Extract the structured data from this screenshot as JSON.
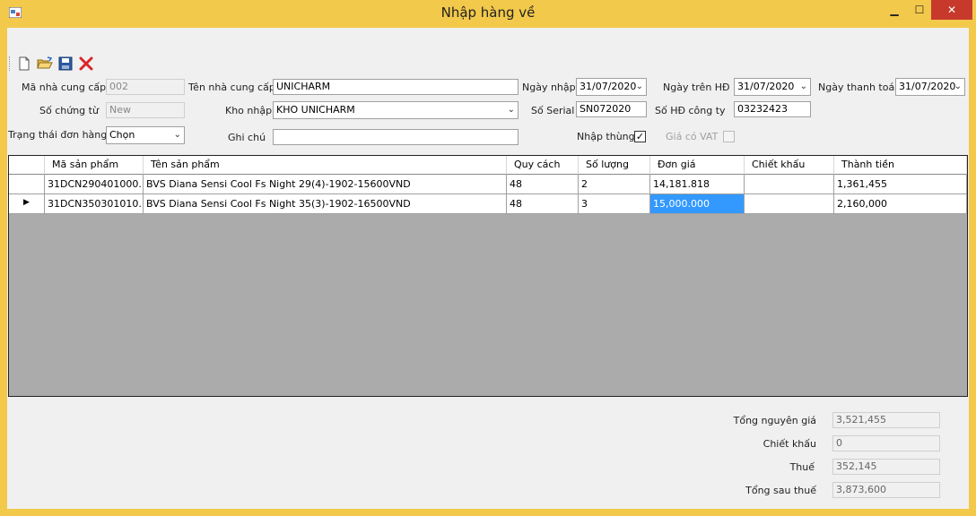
{
  "window": {
    "title": "Nhập hàng về",
    "min_label": "▁",
    "max_label": "☐",
    "close_label": "✕"
  },
  "toolbar": {
    "icons": [
      "new-icon",
      "open-icon",
      "save-icon",
      "delete-icon"
    ]
  },
  "form": {
    "supplier_code": {
      "label": "Mã nhà cung cấp",
      "value": "002"
    },
    "supplier_name": {
      "label": "Tên nhà cung cấp",
      "value": "UNICHARM"
    },
    "import_date": {
      "label": "Ngày nhập",
      "value": "31/07/2020"
    },
    "invoice_date": {
      "label": "Ngày trên HĐ",
      "value": "31/07/2020"
    },
    "payment_date": {
      "label": "Ngày thanh toán",
      "value": "31/07/2020"
    },
    "voucher_no": {
      "label": "Số chứng từ",
      "value": "New"
    },
    "warehouse": {
      "label": "Kho nhập",
      "value": "KHO UNICHARM"
    },
    "serial": {
      "label": "Số Serial",
      "value": "SN072020"
    },
    "company_invoice": {
      "label": "Số HĐ công ty",
      "value": "03232423"
    },
    "order_status": {
      "label": "Trạng thái đơn hàng",
      "value": "Chọn"
    },
    "note": {
      "label": "Ghi chú",
      "value": ""
    },
    "import_carton": {
      "label": "Nhập thùng",
      "checked": true,
      "mark": "✓"
    },
    "vat_price": {
      "label": "Giá có VAT",
      "checked": false,
      "mark": ""
    }
  },
  "grid": {
    "columns": [
      "Mã sản phẩm",
      "Tên sản phẩm",
      "Quy cách",
      "Số lượng",
      "Đơn giá",
      "Chiết khấu",
      "Thành tiền"
    ],
    "rows": [
      {
        "indicator": "",
        "cells": [
          "31DCN290401000...",
          "BVS Diana Sensi Cool Fs Night 29(4)-1902-15600VND",
          "48",
          "2",
          "14,181.818",
          "",
          "1,361,455"
        ]
      },
      {
        "indicator": "▶",
        "cells": [
          "31DCN350301010...",
          "BVS Diana Sensi Cool Fs Night 35(3)-1902-16500VND",
          "48",
          "3",
          "15,000.000",
          "",
          "2,160,000"
        ]
      }
    ]
  },
  "summary": {
    "subtotal": {
      "label": "Tổng nguyên giá",
      "value": "3,521,455"
    },
    "discount": {
      "label": "Chiết khấu",
      "value": "0"
    },
    "tax": {
      "label": "Thuế",
      "value": "352,145"
    },
    "total": {
      "label": "Tổng sau thuế",
      "value": "3,873,600"
    }
  }
}
